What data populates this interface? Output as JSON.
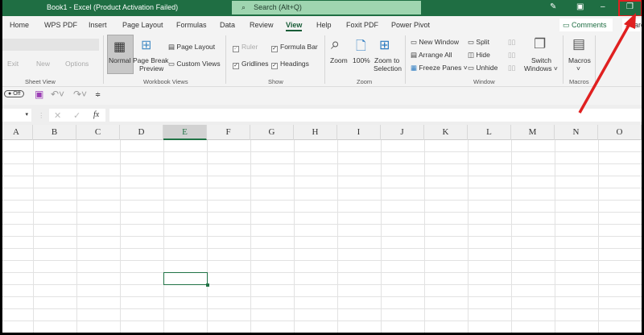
{
  "titlebar": {
    "title": "Book1  -  Excel (Product Activation Failed)",
    "search_placeholder": "Search (Alt+Q)",
    "accent": "#1f6e43"
  },
  "tabs": [
    "Home",
    "WPS PDF",
    "Insert",
    "Page Layout",
    "Formulas",
    "Data",
    "Review",
    "View",
    "Help",
    "Foxit PDF",
    "Power Pivot"
  ],
  "active_tab": "View",
  "comments_label": "Comments",
  "share_label": "Share",
  "ribbon": {
    "sheet_view": {
      "exit": "Exit",
      "new": "New",
      "options": "Options",
      "group": "Sheet View"
    },
    "workbook_views": {
      "normal": "Normal",
      "page_break": "Page Break",
      "preview": "Preview",
      "page_layout": "Page Layout",
      "custom_views": "Custom Views",
      "group": "Workbook Views"
    },
    "show": {
      "ruler": "Ruler",
      "formula_bar": "Formula Bar",
      "gridlines": "Gridlines",
      "headings": "Headings",
      "group": "Show"
    },
    "zoom": {
      "zoom": "Zoom",
      "hundred": "100%",
      "zoom_to": "Zoom to",
      "selection": "Selection",
      "group": "Zoom"
    },
    "window": {
      "new_window": "New Window",
      "arrange_all": "Arrange All",
      "freeze_panes": "Freeze Panes",
      "split": "Split",
      "hide": "Hide",
      "unhide": "Unhide",
      "switch": "Switch",
      "windows": "Windows",
      "group": "Window"
    },
    "macros": {
      "label": "Macros",
      "group": "Macros"
    }
  },
  "qat": {
    "autosave": "Off"
  },
  "formula_bar": {
    "fx": "fx",
    "value": ""
  },
  "columns": [
    "A",
    "B",
    "C",
    "D",
    "E",
    "F",
    "G",
    "H",
    "I",
    "J",
    "K",
    "L",
    "M",
    "N",
    "O"
  ],
  "selected_column": "E",
  "annotation_color": "#e02020"
}
